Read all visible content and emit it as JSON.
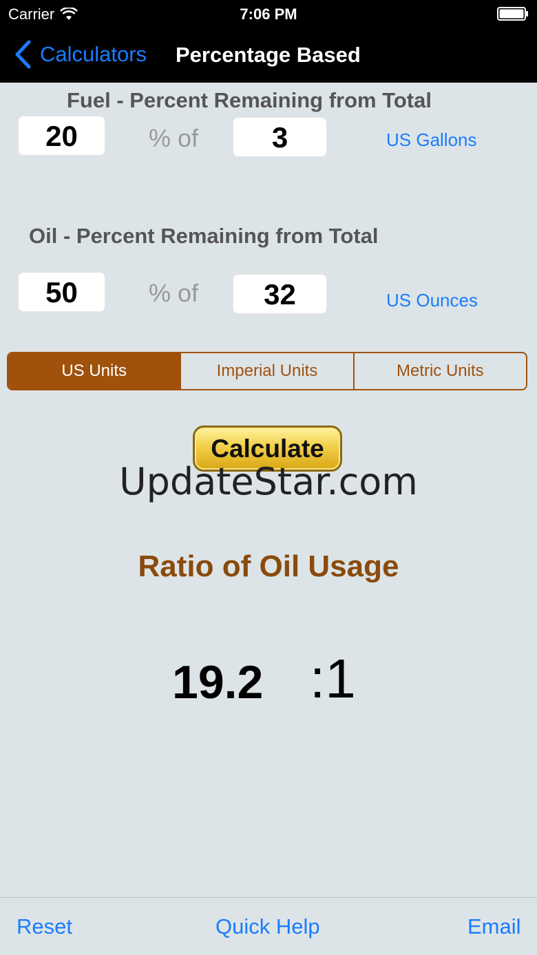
{
  "status_bar": {
    "carrier": "Carrier",
    "time": "7:06 PM"
  },
  "nav": {
    "back_label": "Calculators",
    "title": "Percentage Based"
  },
  "fuel": {
    "title": "Fuel - Percent Remaining from Total",
    "percent": "20",
    "percent_of": "% of",
    "total": "3",
    "unit": "US Gallons"
  },
  "oil": {
    "title": "Oil - Percent Remaining from Total",
    "percent": "50",
    "percent_of": "% of",
    "total": "32",
    "unit": "US Ounces"
  },
  "units_segment": {
    "options": [
      "US Units",
      "Imperial Units",
      "Metric Units"
    ],
    "selected": "US Units"
  },
  "calculate_label": "Calculate",
  "watermark": "UpdateStar.com",
  "result": {
    "title": "Ratio of Oil Usage",
    "value": "19.2",
    "ratio": ":1"
  },
  "toolbar": {
    "reset": "Reset",
    "quick_help": "Quick Help",
    "email": "Email"
  },
  "colors": {
    "accent_blue": "#1a7cff",
    "segment_brown": "#a0510c",
    "result_brown": "#8a4a0c",
    "background": "#dde4e7"
  }
}
